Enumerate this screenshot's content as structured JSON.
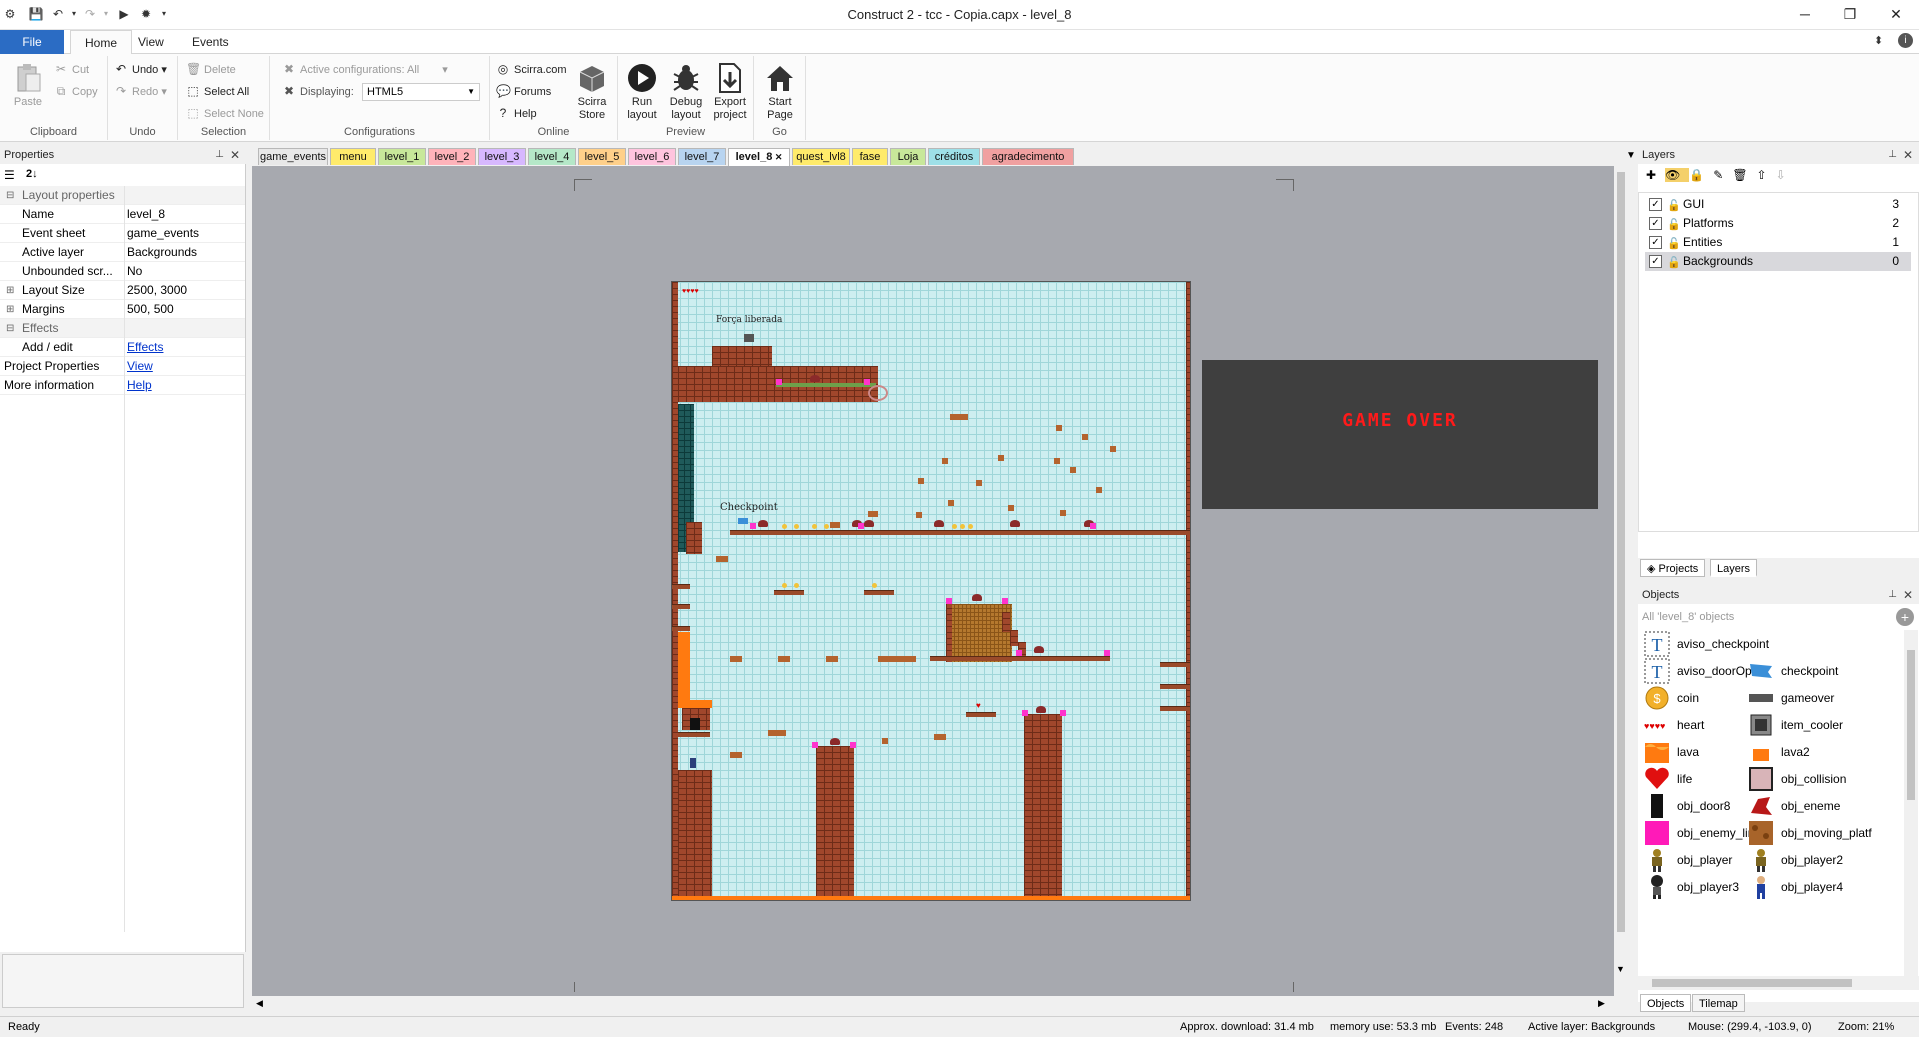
{
  "window": {
    "title": "Construct 2 - tcc - Copia.capx - level_8"
  },
  "ribbon_tabs": [
    "File",
    "Home",
    "View",
    "Events"
  ],
  "ribbon": {
    "clipboard": {
      "label": "Clipboard",
      "paste": "Paste",
      "cut": "Cut",
      "copy": "Copy"
    },
    "undo": {
      "label": "Undo",
      "undo": "Undo",
      "redo": "Redo"
    },
    "selection": {
      "label": "Selection",
      "delete": "Delete",
      "select_all": "Select All",
      "select_none": "Select None"
    },
    "configurations": {
      "label": "Configurations",
      "active": "Active configurations: All",
      "displaying_label": "Displaying:",
      "displaying_value": "HTML5"
    },
    "online": {
      "label": "Online",
      "scirra": "Scirra.com",
      "forums": "Forums",
      "help": "Help",
      "store": "Scirra Store"
    },
    "preview": {
      "label": "Preview",
      "run": "Run layout",
      "debug": "Debug layout",
      "export": "Export project"
    },
    "go": {
      "label": "Go",
      "start": "Start Page"
    }
  },
  "properties": {
    "title": "Properties",
    "rows": [
      {
        "type": "cat",
        "k": "Layout properties"
      },
      {
        "k": "Name",
        "v": "level_8"
      },
      {
        "k": "Event sheet",
        "v": "game_events"
      },
      {
        "k": "Active layer",
        "v": "Backgrounds"
      },
      {
        "k": "Unbounded scr...",
        "v": "No"
      },
      {
        "k": "Layout Size",
        "v": "2500, 3000",
        "exp": true
      },
      {
        "k": "Margins",
        "v": "500, 500",
        "exp": true
      },
      {
        "type": "cat",
        "k": "Effects"
      },
      {
        "k": "Add / edit",
        "v": "Effects",
        "link": true
      },
      {
        "k": "Project Properties",
        "v": "View",
        "link": true,
        "root": true
      },
      {
        "k": "More information",
        "v": "Help",
        "link": true,
        "root": true
      }
    ]
  },
  "layout_tabs": [
    {
      "label": "game_events",
      "color": "#e8e8e8"
    },
    {
      "label": "menu",
      "color": "#ffeb6b"
    },
    {
      "label": "level_1",
      "color": "#c8e89a"
    },
    {
      "label": "level_2",
      "color": "#ffb3ba"
    },
    {
      "label": "level_3",
      "color": "#d7b8ff"
    },
    {
      "label": "level_4",
      "color": "#b5e8c8"
    },
    {
      "label": "level_5",
      "color": "#ffd08a"
    },
    {
      "label": "level_6",
      "color": "#ffc4de"
    },
    {
      "label": "level_7",
      "color": "#b8d4f0"
    },
    {
      "label": "level_8",
      "color": "#ffffff"
    },
    {
      "label": "quest_lvl8",
      "color": "#ffeb6b"
    },
    {
      "label": "fase",
      "color": "#ffeb6b"
    },
    {
      "label": "Loja",
      "color": "#c8e89a"
    },
    {
      "label": "créditos",
      "color": "#9ee0e8"
    },
    {
      "label": "agradecimento",
      "color": "#f0a0a0"
    }
  ],
  "canvas_texts": {
    "forca": "Força liberada",
    "checkpoint": "Checkpoint",
    "gameover": "GAME OVER"
  },
  "layers": {
    "title": "Layers",
    "items": [
      {
        "name": "GUI",
        "num": "3"
      },
      {
        "name": "Platforms",
        "num": "2"
      },
      {
        "name": "Entities",
        "num": "1"
      },
      {
        "name": "Backgrounds",
        "num": "0"
      }
    ],
    "tabs": [
      "Projects",
      "Layers"
    ]
  },
  "objects": {
    "title": "Objects",
    "filter_placeholder": "All 'level_8' objects",
    "items": [
      {
        "name": "aviso_checkpoint",
        "icon": "text-T"
      },
      {
        "name": "aviso_doorOpen",
        "icon": "text-T"
      },
      {
        "name": "checkpoint",
        "icon": "flag"
      },
      {
        "name": "coin",
        "icon": "coin"
      },
      {
        "name": "gameover",
        "icon": "bar"
      },
      {
        "name": "heart",
        "icon": "hearts"
      },
      {
        "name": "item_cooler",
        "icon": "cooler"
      },
      {
        "name": "lava",
        "icon": "lava"
      },
      {
        "name": "lava2",
        "icon": "lava2"
      },
      {
        "name": "life",
        "icon": "heart-big"
      },
      {
        "name": "obj_collision",
        "icon": "square"
      },
      {
        "name": "obj_door8",
        "icon": "door"
      },
      {
        "name": "obj_eneme",
        "icon": "enemy"
      },
      {
        "name": "obj_enemy_limit",
        "icon": "pink"
      },
      {
        "name": "obj_moving_platf",
        "icon": "platform"
      },
      {
        "name": "obj_player",
        "icon": "player"
      },
      {
        "name": "obj_player2",
        "icon": "player"
      },
      {
        "name": "obj_player3",
        "icon": "player3"
      },
      {
        "name": "obj_player4",
        "icon": "player4"
      }
    ],
    "tabs": [
      "Objects",
      "Tilemap"
    ]
  },
  "status": {
    "ready": "Ready",
    "download": "Approx. download: 31.4 mb",
    "memory": "memory use: 53.3 mb",
    "events": "Events: 248",
    "layer": "Active layer: Backgrounds",
    "mouse": "Mouse: (299.4, -103.9, 0)",
    "zoom": "Zoom: 21%"
  }
}
